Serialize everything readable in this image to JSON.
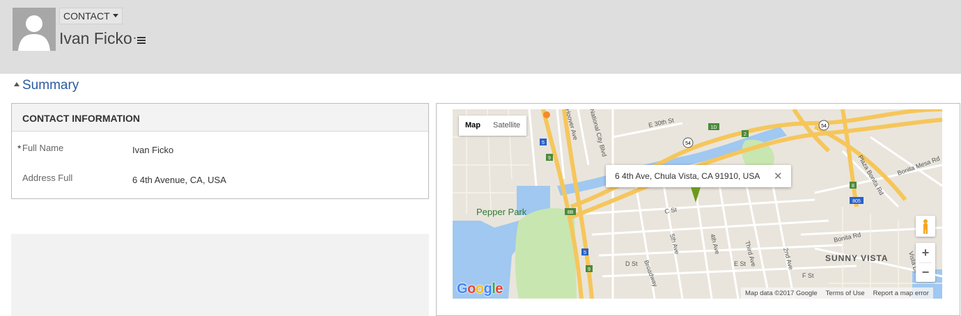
{
  "header": {
    "entity_label": "CONTACT",
    "record_name": "Ivan Ficko"
  },
  "section": {
    "title": "Summary"
  },
  "contact_card": {
    "heading": "CONTACT INFORMATION",
    "fields": [
      {
        "label": "Full Name",
        "value": "Ivan Ficko",
        "required_marker": "*"
      },
      {
        "label": "Address Full",
        "value": "6 4th Avenue, CA, USA",
        "required_marker": ""
      }
    ]
  },
  "map": {
    "type_buttons": [
      "Map",
      "Satellite"
    ],
    "active_type": "Map",
    "popup_address": "6 4th Ave, Chula Vista, CA 91910, USA",
    "popup_close": "✕",
    "zoom_in": "+",
    "zoom_out": "−",
    "attribution": {
      "data": "Map data ©2017 Google",
      "terms": "Terms of Use",
      "report": "Report a map error"
    },
    "labels": {
      "park": "Pepper Park",
      "area": "SUNNY VISTA",
      "street_e30": "E 30th St",
      "street_c": "C St",
      "street_d": "D St",
      "street_e": "E St",
      "street_f": "F St",
      "street_4th": "4th Ave",
      "street_5th": "5th Ave",
      "street_third": "Third Ave",
      "street_2nd": "2nd Ave",
      "street_broadway": "Broadway",
      "street_plaza": "Plaza Bonita Rd",
      "street_bonita": "Bonita Rd",
      "street_bonita_mesa": "Bonita Mesa Rd",
      "street_natcity": "National City Blvd",
      "street_hoover": "Hoover Ave",
      "street_vista": "Vista Dr",
      "shield_5a": "5",
      "shield_5b": "5",
      "shield_54a": "54",
      "shield_54b": "54",
      "shield_805": "805",
      "exit_9a": "9",
      "exit_9b": "9",
      "exit_8b": "8B",
      "exit_1d": "1D",
      "exit_2": "2",
      "exit_8": "8"
    },
    "google_letters": [
      "G",
      "o",
      "o",
      "g",
      "l",
      "e"
    ],
    "google_colors": [
      "#4285f4",
      "#ea4335",
      "#fbbc05",
      "#4285f4",
      "#34a853",
      "#ea4335"
    ]
  },
  "colors": {
    "header_bg": "#dedede",
    "section_title": "#2c5aa0",
    "water": "#a0c8f0",
    "park": "#c8e6b0",
    "highway": "#f6c65b",
    "pin": "#6c9a1f"
  }
}
